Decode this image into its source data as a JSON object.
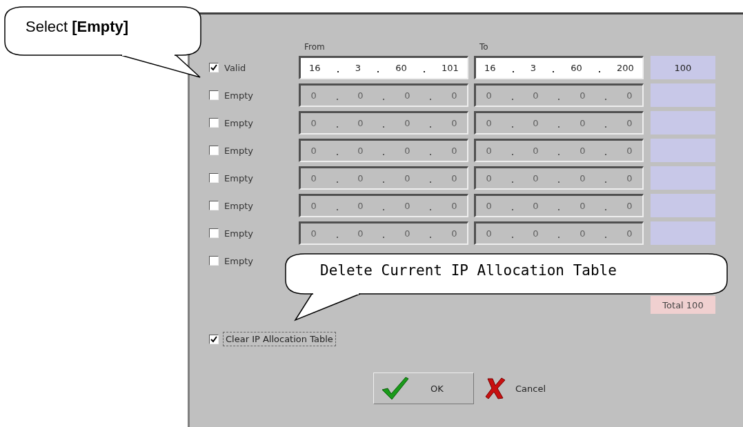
{
  "callouts": [
    {
      "text": "Select **[Empty]**",
      "kind": "sans"
    },
    {
      "text": "Delete Current IP Allocation Table",
      "kind": "mono"
    }
  ],
  "table": {
    "columns": [
      "From",
      "To"
    ],
    "rows": [
      {
        "label": "Valid",
        "checked": true,
        "disabled": false,
        "from": [
          "16",
          "3",
          "60",
          "101"
        ],
        "to": [
          "16",
          "3",
          "60",
          "200"
        ],
        "count": "100"
      },
      {
        "label": "Empty",
        "checked": false,
        "disabled": true,
        "from": [
          "0",
          "0",
          "0",
          "0"
        ],
        "to": [
          "0",
          "0",
          "0",
          "0"
        ]
      },
      {
        "label": "Empty",
        "checked": false,
        "disabled": true,
        "from": [
          "0",
          "0",
          "0",
          "0"
        ],
        "to": [
          "0",
          "0",
          "0",
          "0"
        ]
      },
      {
        "label": "Empty",
        "checked": false,
        "disabled": true,
        "from": [
          "0",
          "0",
          "0",
          "0"
        ],
        "to": [
          "0",
          "0",
          "0",
          "0"
        ]
      },
      {
        "label": "Empty",
        "checked": false,
        "disabled": true,
        "from": [
          "0",
          "0",
          "0",
          "0"
        ],
        "to": [
          "0",
          "0",
          "0",
          "0"
        ]
      },
      {
        "label": "Empty",
        "checked": false,
        "disabled": true,
        "from": [
          "0",
          "0",
          "0",
          "0"
        ],
        "to": [
          "0",
          "0",
          "0",
          "0"
        ]
      },
      {
        "label": "Empty",
        "checked": false,
        "disabled": true,
        "from": [
          "0",
          "0",
          "0",
          "0"
        ],
        "to": [
          "0",
          "0",
          "0",
          "0"
        ]
      },
      {
        "label": "Empty",
        "checked": false
      }
    ],
    "total": "Total 100"
  },
  "clear_table": {
    "label": "Clear IP Allocation Table",
    "checked": true
  },
  "buttons": [
    {
      "label": "OK",
      "kind": "ok"
    },
    {
      "label": "Cancel",
      "kind": "cancel"
    }
  ]
}
